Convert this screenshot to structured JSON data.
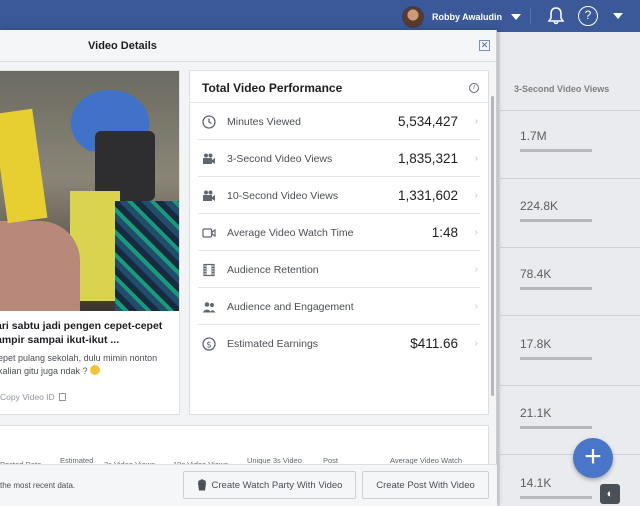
{
  "topbar": {
    "user_name": "Robby Awaludin",
    "help_glyph": "?"
  },
  "background_table": {
    "column_title": "3-Second Video Views",
    "values": [
      "1.7M",
      "224.8K",
      "78.4K",
      "17.8K",
      "21.1K",
      "14.1K"
    ]
  },
  "modal": {
    "title": "Video Details",
    "close_glyph": "✕",
    "video": {
      "title_line1": "ari sabtu jadi pengen cepet-cepet",
      "title_line2": "ampir sampai ikut-ikut ...",
      "desc_line1": "epet pulang sekolah, dulu mimin nonton",
      "desc_line2": "kalian gitu juga ndak ?",
      "copy_label": "Copy Video ID"
    },
    "performance": {
      "title": "Total Video Performance",
      "info_glyph": "i",
      "rows": [
        {
          "label": "Minutes Viewed",
          "value": "5,534,427",
          "icon": "clock-icon"
        },
        {
          "label": "3-Second Video Views",
          "value": "1,835,321",
          "icon": "video-camera-icon"
        },
        {
          "label": "10-Second Video Views",
          "value": "1,331,602",
          "icon": "video-camera-icon"
        },
        {
          "label": "Average Video Watch Time",
          "value": "1:48",
          "icon": "video-play-icon"
        },
        {
          "label": "Audience Retention",
          "value": "",
          "icon": "film-icon"
        },
        {
          "label": "Audience and Engagement",
          "value": "",
          "icon": "people-icon"
        },
        {
          "label": "Estimated Earnings",
          "value": "$411.66",
          "icon": "dollar-icon"
        }
      ],
      "chevron": "›"
    },
    "table_headers": {
      "posted_date": "Posted Date",
      "estimated": "Estimated",
      "three_sec": "3s Video Views",
      "ten_sec": "10s Video Views",
      "unique": "Unique 3s Video",
      "post": "Post",
      "avg_watch": "Average Video Watch"
    },
    "footer": {
      "note": "the most recent data.",
      "watch_party_label": "Create Watch Party With Video",
      "create_post_label": "Create Post With Video"
    }
  },
  "fab_glyph": "+",
  "globe_glyph": "◐",
  "colors": {
    "brand_blue": "#3b5998",
    "fab_blue": "#4a76c9"
  }
}
